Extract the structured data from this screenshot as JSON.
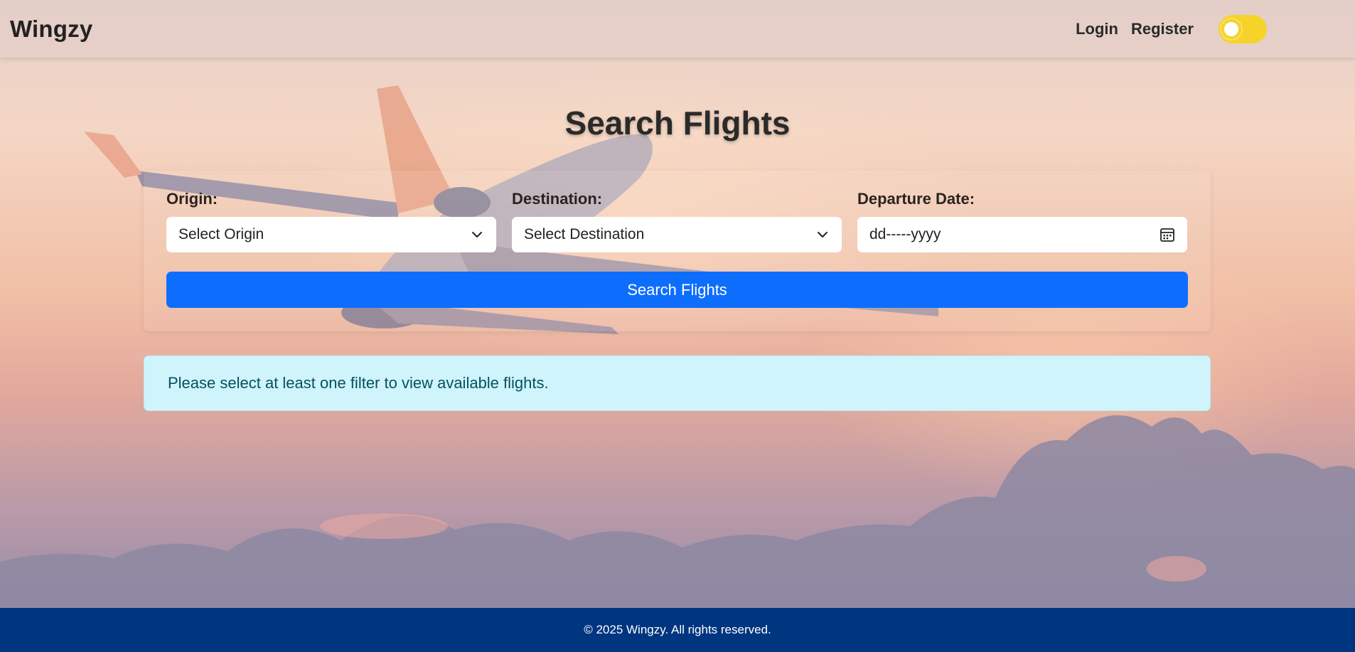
{
  "header": {
    "brand": "Wingzy",
    "nav": {
      "login": "Login",
      "register": "Register"
    },
    "theme_toggle": {
      "state": "on"
    }
  },
  "main": {
    "title": "Search Flights",
    "form": {
      "origin": {
        "label": "Origin:",
        "value": "Select Origin"
      },
      "destination": {
        "label": "Destination:",
        "value": "Select Destination"
      },
      "departure_date": {
        "label": "Departure Date:",
        "placeholder": "dd-----yyyy"
      },
      "submit_label": "Search Flights"
    },
    "alert": "Please select at least one filter to view available flights."
  },
  "footer": {
    "text": "© 2025 Wingzy. All rights reserved."
  },
  "colors": {
    "primary": "#0d6efd",
    "footer_bg": "#003580",
    "alert_bg": "#cff4fc",
    "alert_text": "#055160",
    "toggle": "#f5d32a"
  }
}
